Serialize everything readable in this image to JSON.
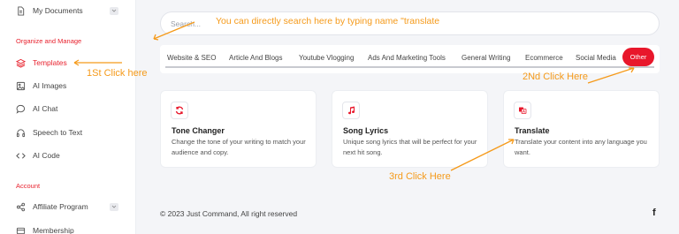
{
  "sidebar": {
    "items": [
      {
        "label": "My Documents"
      },
      {
        "label": "Templates"
      },
      {
        "label": "AI Images"
      },
      {
        "label": "AI Chat"
      },
      {
        "label": "Speech to Text"
      },
      {
        "label": "AI Code"
      },
      {
        "label": "Affiliate Program"
      },
      {
        "label": "Membership"
      }
    ],
    "sections": {
      "organize": "Organize and Manage",
      "account": "Account"
    }
  },
  "search": {
    "placeholder": "Search..."
  },
  "tabs": [
    {
      "label": "Website & SEO"
    },
    {
      "label": "Article And Blogs"
    },
    {
      "label": "Youtube Vlogging"
    },
    {
      "label": "Ads And Marketing Tools"
    },
    {
      "label": "General Writing"
    },
    {
      "label": "Ecommerce"
    },
    {
      "label": "Social Media"
    },
    {
      "label": "Other"
    }
  ],
  "cards": [
    {
      "title": "Tone Changer",
      "desc": "Change the tone of your writing to match your audience and copy.",
      "icon": "refresh-icon"
    },
    {
      "title": "Song Lyrics",
      "desc": "Unique song lyrics that will be perfect for your next hit song.",
      "icon": "music-note-icon"
    },
    {
      "title": "Translate",
      "desc": "Translate your content into any language you want.",
      "icon": "translate-icon"
    }
  ],
  "annotations": {
    "search_hint": "You can directly search here by typing name \"translate",
    "step1": "1St Click here",
    "step2": "2Nd Click Here",
    "step3": "3rd Click Here"
  },
  "footer": {
    "copyright": "© 2023 Just Command, All right reserved",
    "social": "f"
  },
  "colors": {
    "accent": "#e8172b",
    "annotation": "#f59a1a"
  }
}
